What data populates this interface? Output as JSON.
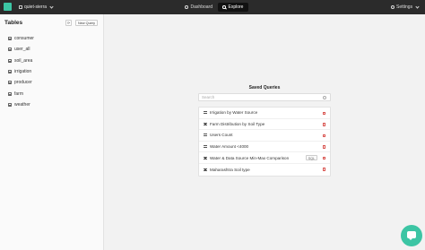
{
  "topbar": {
    "workspace": "quiet-sierra",
    "dashboard_label": "Dashboard",
    "explore_label": "Explore",
    "settings_label": "Settings"
  },
  "sidebar": {
    "title": "Tables",
    "new_query_label": "New Query",
    "tables": [
      {
        "label": "consumer"
      },
      {
        "label": "user_all"
      },
      {
        "label": "soil_area"
      },
      {
        "label": "irrigation"
      },
      {
        "label": "producer"
      },
      {
        "label": "farm"
      },
      {
        "label": "weather"
      }
    ]
  },
  "saved_queries": {
    "title": "Saved Queries",
    "search_placeholder": "Search",
    "items": [
      {
        "label": "Irrigation by Water Source"
      },
      {
        "label": "Farm Distribution by Soil Type"
      },
      {
        "label": "Users Count"
      },
      {
        "label": "Water Amount <4000"
      },
      {
        "label": "Water & Data Source Min-Max Comparison",
        "tag": "SQL"
      },
      {
        "label": "Maharashtra Soil type"
      }
    ]
  },
  "colors": {
    "accent": "#3cc5a4",
    "topbar": "#2b2b2b",
    "delete": "#d9534f"
  }
}
